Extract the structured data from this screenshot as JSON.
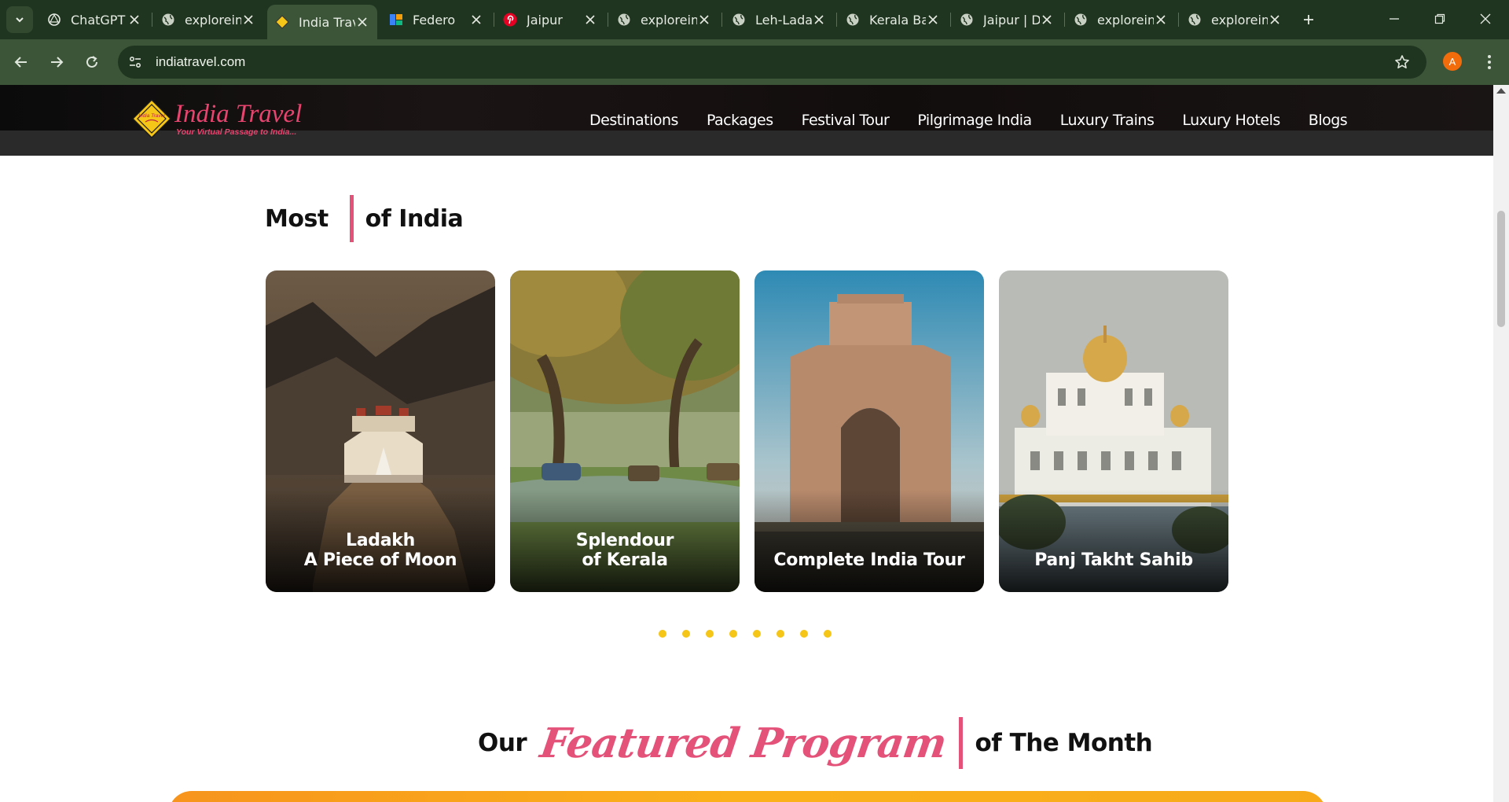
{
  "browser": {
    "tabs": [
      {
        "title": "ChatGPT",
        "icon": "chatgpt-icon",
        "active": false
      },
      {
        "title": "exploreind",
        "icon": "globe-icon",
        "active": false
      },
      {
        "title": "India Travel",
        "icon": "indiatravel-icon",
        "active": true
      },
      {
        "title": "Federo",
        "icon": "federo-icon",
        "active": false
      },
      {
        "title": "Jaipur",
        "icon": "pinterest-icon",
        "active": false
      },
      {
        "title": "exploreind",
        "icon": "globe-icon",
        "active": false
      },
      {
        "title": "Leh-Ladakh",
        "icon": "globe-icon",
        "active": false
      },
      {
        "title": "Kerala Ba",
        "icon": "globe-icon",
        "active": false
      },
      {
        "title": "Jaipur | D",
        "icon": "globe-icon",
        "active": false
      },
      {
        "title": "exploreind",
        "icon": "globe-icon",
        "active": false
      },
      {
        "title": "exploreind",
        "icon": "globe-icon",
        "active": false
      }
    ],
    "url": "indiatravel.com",
    "profile_initial": "A",
    "accent": "#f36c0c"
  },
  "site": {
    "logo_title": "India Travel",
    "logo_tagline": "Your Virtual Passage to India...",
    "logo_badge": "India Travel",
    "nav": [
      "Destinations",
      "Packages",
      "Festival Tour",
      "Pilgrimage India",
      "Luxury Trains",
      "Luxury Hotels",
      "Blogs"
    ]
  },
  "most": {
    "word_before": "Most",
    "word_after": "of India",
    "cards": [
      {
        "line1": "Ladakh",
        "line2": "A Piece of Moon"
      },
      {
        "line1": "Splendour",
        "line2": "of Kerala"
      },
      {
        "line1": "Complete India Tour",
        "line2": ""
      },
      {
        "line1": "Panj Takht Sahib",
        "line2": ""
      }
    ],
    "dot_count": 8,
    "dot_color": "#f5c518"
  },
  "featured": {
    "word1": "Our",
    "script": "Featured Program",
    "word2": "of The Month",
    "accent": "#e4527a"
  }
}
